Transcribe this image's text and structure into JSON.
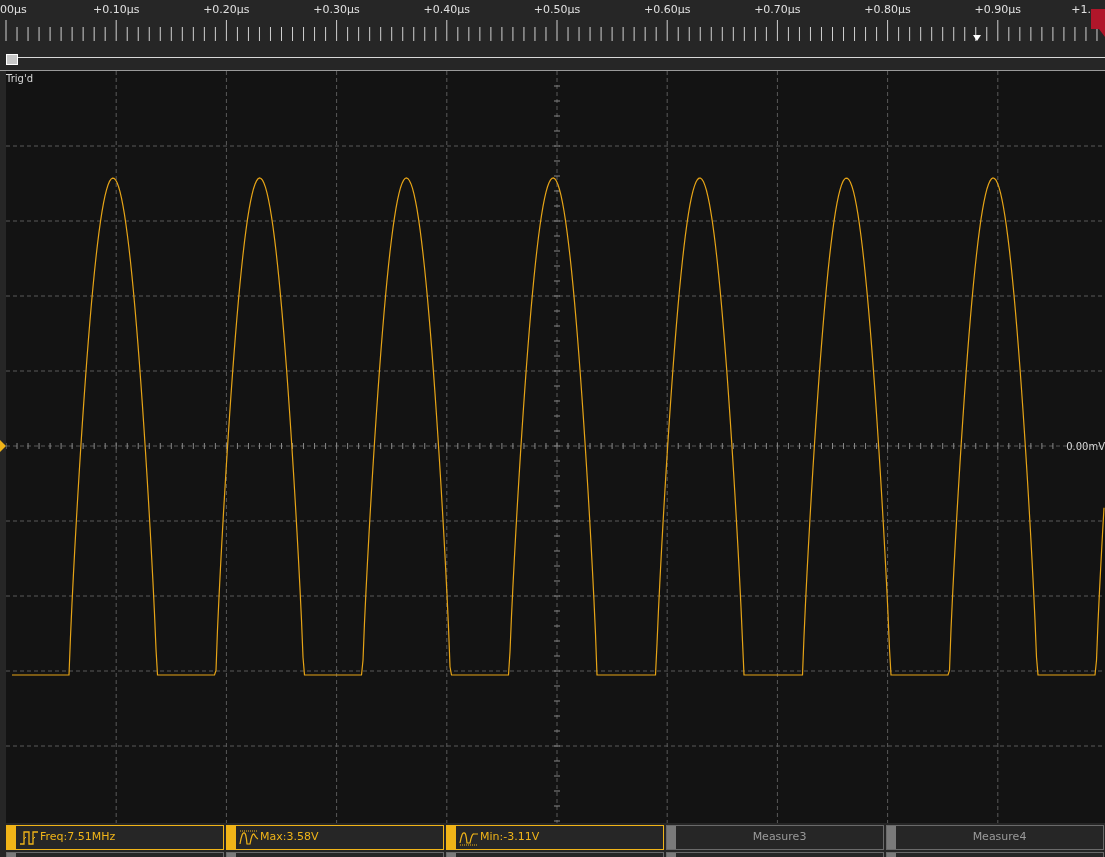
{
  "timebase": {
    "labels": [
      "00μs",
      "+0.10μs",
      "+0.20μs",
      "+0.30μs",
      "+0.40μs",
      "+0.50μs",
      "+0.60μs",
      "+0.70μs",
      "+0.80μs",
      "+0.90μs",
      "+1."
    ]
  },
  "plot": {
    "status": "Trig'd",
    "offset_label": "0.00mV"
  },
  "measurements": [
    {
      "kind": "freq",
      "label": "Freq:7.51MHz",
      "active": true
    },
    {
      "kind": "max",
      "label": "Max:3.58V",
      "active": true
    },
    {
      "kind": "min",
      "label": "Min:-3.11V",
      "active": true
    },
    {
      "label": "Measure3",
      "active": false
    },
    {
      "label": "Measure4",
      "active": false
    }
  ]
}
